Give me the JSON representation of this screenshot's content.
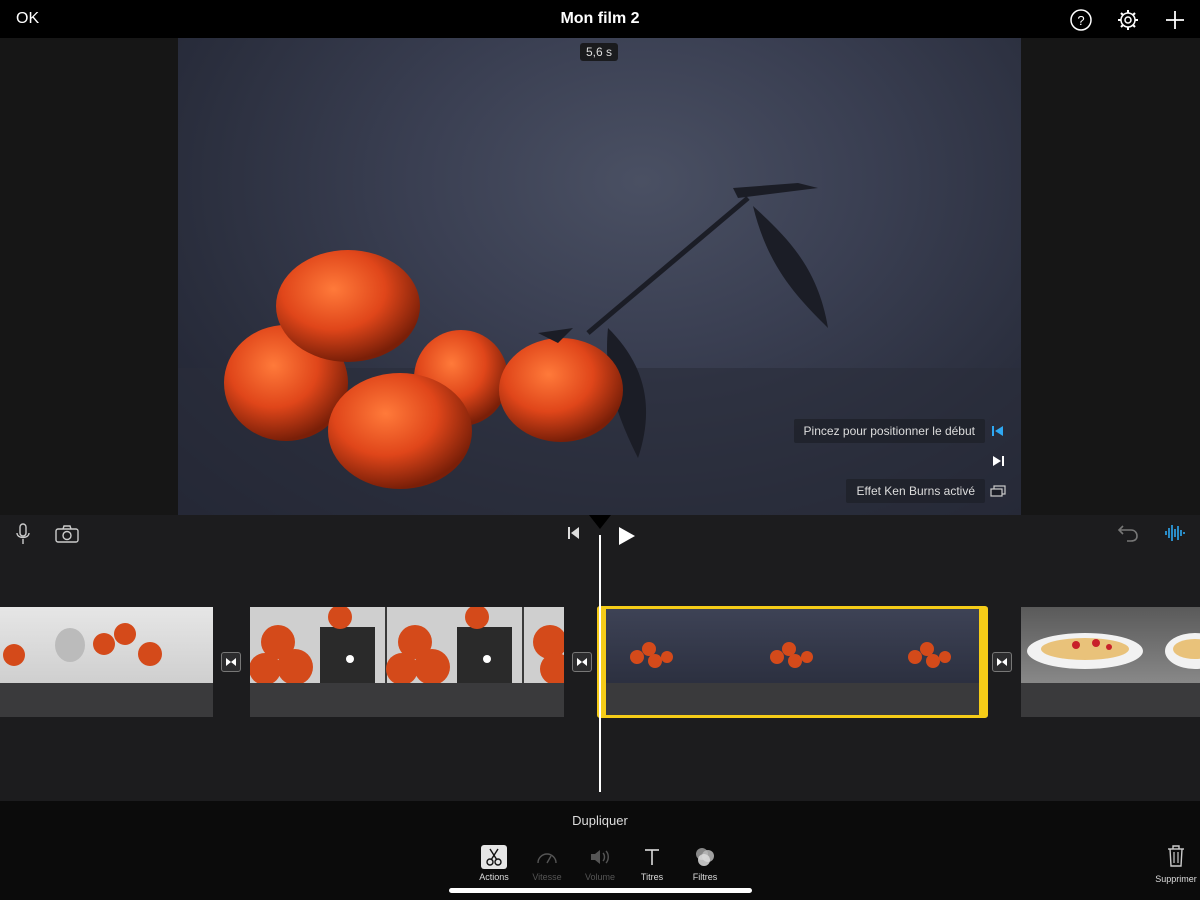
{
  "header": {
    "ok_label": "OK",
    "title": "Mon film 2",
    "icons": [
      "help-icon",
      "settings-gear-icon",
      "add-plus-icon"
    ]
  },
  "viewer": {
    "duration": "5,6 s",
    "hint_start": "Pincez pour positionner le début",
    "hint_ken_burns": "Effet Ken Burns activé"
  },
  "timeline": {
    "left_icons": [
      "microphone-icon",
      "camera-icon"
    ],
    "center_icons": [
      "skip-to-start-icon",
      "play-icon"
    ],
    "right_icons": [
      "undo-icon",
      "audio-waveform-icon"
    ],
    "accent_color": "#f5cc18",
    "waveform_color": "#2ea8f2"
  },
  "bottombar": {
    "action_label": "Dupliquer",
    "tools": [
      {
        "label": "Actions",
        "icon": "scissors-icon",
        "enabled": true,
        "active": true
      },
      {
        "label": "Vitesse",
        "icon": "speedometer-icon",
        "enabled": false
      },
      {
        "label": "Volume",
        "icon": "speaker-icon",
        "enabled": false
      },
      {
        "label": "Titres",
        "icon": "text-t-icon",
        "enabled": true
      },
      {
        "label": "Filtres",
        "icon": "filters-circles-icon",
        "enabled": true
      }
    ],
    "delete_label": "Supprimer"
  }
}
